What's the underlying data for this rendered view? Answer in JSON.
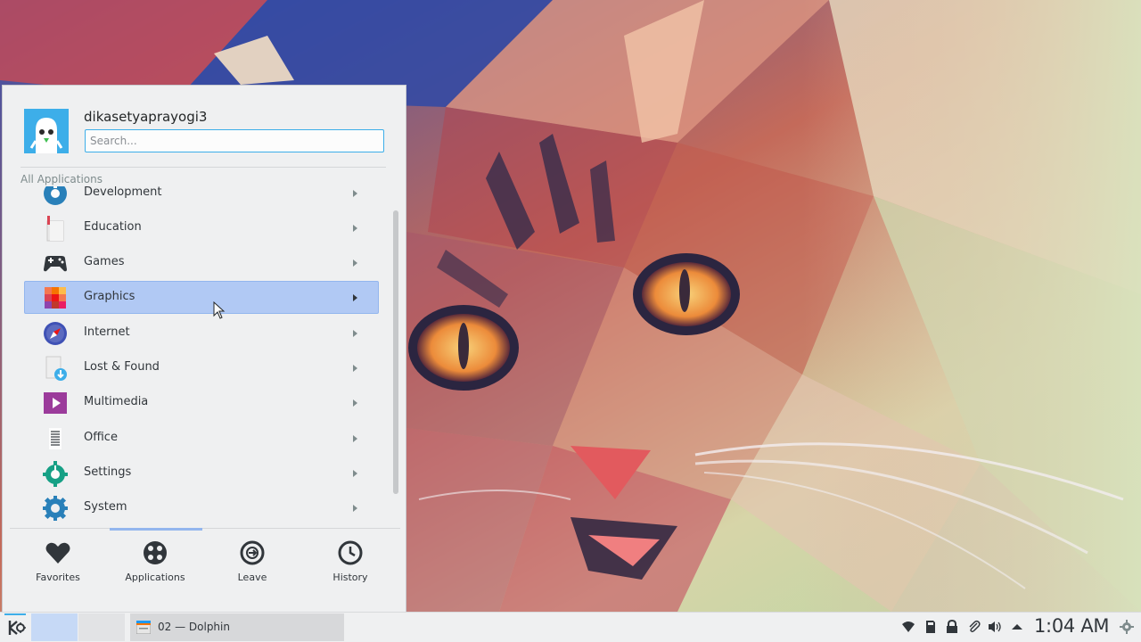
{
  "user": {
    "name": "dikasetyaprayogi3"
  },
  "search": {
    "placeholder": "Search...",
    "value": ""
  },
  "launcher": {
    "section_label": "All Applications",
    "categories": [
      {
        "label": "Development",
        "icon": "development-icon"
      },
      {
        "label": "Education",
        "icon": "education-icon"
      },
      {
        "label": "Games",
        "icon": "games-icon"
      },
      {
        "label": "Graphics",
        "icon": "graphics-icon",
        "highlighted": true
      },
      {
        "label": "Internet",
        "icon": "internet-icon"
      },
      {
        "label": "Lost & Found",
        "icon": "lost-found-icon"
      },
      {
        "label": "Multimedia",
        "icon": "multimedia-icon"
      },
      {
        "label": "Office",
        "icon": "office-icon"
      },
      {
        "label": "Settings",
        "icon": "settings-icon"
      },
      {
        "label": "System",
        "icon": "system-icon"
      }
    ],
    "tabs": [
      {
        "label": "Favorites",
        "icon": "heart-icon"
      },
      {
        "label": "Applications",
        "icon": "applications-icon",
        "active": true
      },
      {
        "label": "Leave",
        "icon": "leave-icon"
      },
      {
        "label": "History",
        "icon": "clock-icon"
      }
    ]
  },
  "taskbar": {
    "tasks": [
      {
        "label": "02 — Dolphin",
        "icon": "dolphin-icon"
      }
    ],
    "clock": "1:04 AM",
    "tray": [
      "wifi-icon",
      "sd-card-icon",
      "lock-icon",
      "paperclip-icon",
      "volume-icon",
      "expand-tray-icon",
      "settings-gear-icon"
    ]
  },
  "colors": {
    "accent": "#3daee9",
    "highlight": "#b1c9f4",
    "panel": "#eff0f1"
  }
}
